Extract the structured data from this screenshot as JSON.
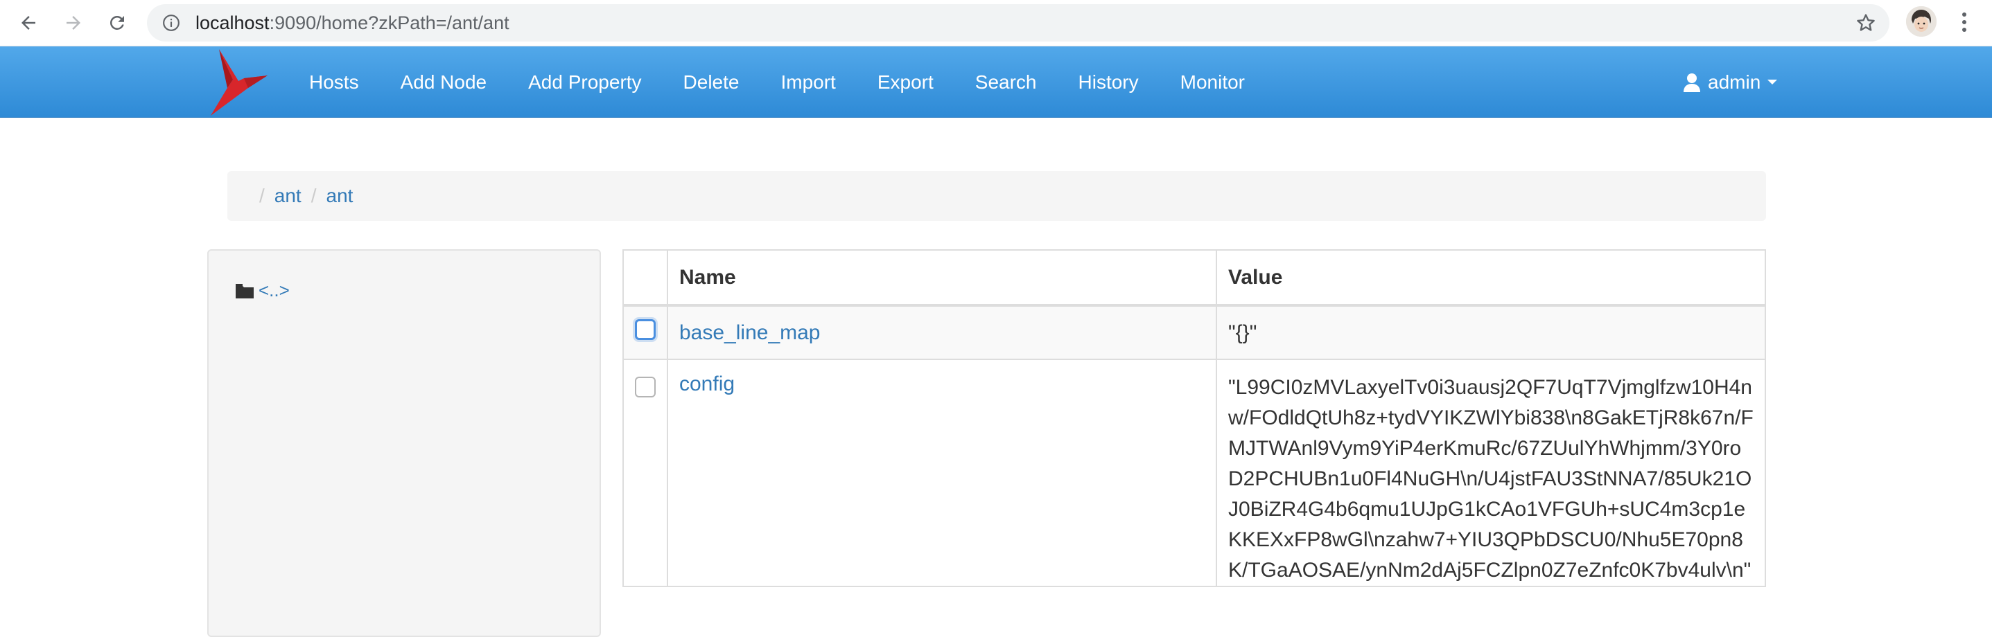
{
  "browser": {
    "url_host": "localhost",
    "url_rest": ":9090/home?zkPath=/ant/ant"
  },
  "navbar": {
    "items": [
      "Hosts",
      "Add Node",
      "Add Property",
      "Delete",
      "Import",
      "Export",
      "Search",
      "History",
      "Monitor"
    ],
    "user": "admin"
  },
  "breadcrumb": {
    "items": [
      "ant",
      "ant"
    ]
  },
  "left_panel": {
    "parent_link": "<..>"
  },
  "table": {
    "headers": {
      "name": "Name",
      "value": "Value"
    },
    "rows": [
      {
        "name": "base_line_map",
        "value": "\"{}\""
      },
      {
        "name": "config",
        "value": "\"L99CI0zMVLaxyelTv0i3uausj2QF7UqT7Vjmglfzw10H4nw/FOdldQtUh8z+tydVYIKZWlYbi838\\n8GakETjR8k67n/FMJTWAnl9Vym9YiP4erKmuRc/67ZUulYhWhjmm/3Y0roD2PCHUBn1u0Fl4NuGH\\n/U4jstFAU3StNNA7/85Uk21OJ0BiZR4G4b6qmu1UJpG1kCAo1VFGUh+sUC4m3cp1eKKEXxFP8wGl\\nzahw7+YIU3QPbDSCU0/Nhu5E70pn8K/TGaAOSAE/ynNm2dAj5FCZlpn0Z7eZnfc0K7bv4ulv\\n\""
      }
    ]
  },
  "colors": {
    "navbar_top": "#52a8ea",
    "navbar_bottom": "#2e8ad6",
    "link": "#337ab7"
  }
}
